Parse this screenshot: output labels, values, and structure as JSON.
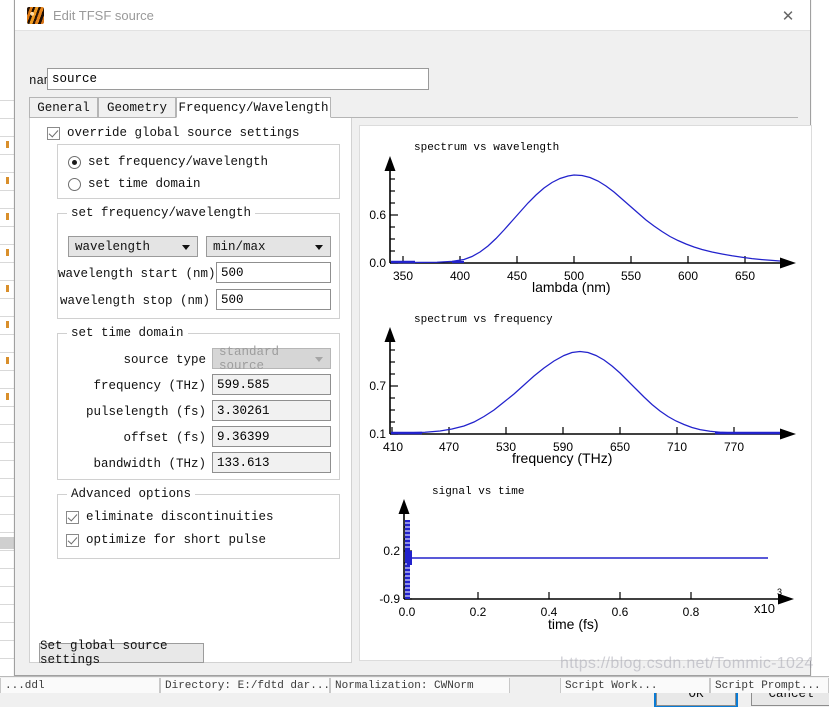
{
  "window": {
    "title": "Edit TFSF source",
    "icon": "lumerical-app-icon",
    "close_label": "✕"
  },
  "name_row": {
    "label": "name",
    "value": "source",
    "placeholder": "name"
  },
  "tabs": [
    {
      "label": "General",
      "active": false
    },
    {
      "label": "Geometry",
      "active": false
    },
    {
      "label": "Frequency/Wavelength",
      "active": true
    }
  ],
  "override": {
    "label": "override global source settings",
    "checked": true
  },
  "mode_radios": [
    {
      "label": "set frequency/wavelength",
      "selected": true
    },
    {
      "label": "set time domain",
      "selected": false
    }
  ],
  "freq_wavelength_group": {
    "legend": "set frequency/wavelength",
    "combo_quantity": {
      "value": "wavelength"
    },
    "combo_range": {
      "value": "min/max"
    },
    "fields": [
      {
        "label": "wavelength start (nm)",
        "value": "500"
      },
      {
        "label": "wavelength stop (nm)",
        "value": "500"
      }
    ]
  },
  "time_domain_group": {
    "legend": "set time domain",
    "source_type": {
      "label": "source type",
      "value": "standard source",
      "disabled": true
    },
    "fields": [
      {
        "label": "frequency (THz)",
        "value": "599.585"
      },
      {
        "label": "pulselength (fs)",
        "value": "3.30261"
      },
      {
        "label": "offset (fs)",
        "value": "9.36399"
      },
      {
        "label": "bandwidth (THz)",
        "value": "133.613"
      }
    ]
  },
  "advanced_group": {
    "legend": "Advanced options",
    "options": [
      {
        "label": "eliminate discontinuities",
        "checked": true
      },
      {
        "label": "optimize for short pulse",
        "checked": true
      }
    ]
  },
  "global_button": {
    "label": "Set global source settings"
  },
  "footer": {
    "ok_label": "OK",
    "cancel_label": "Cancel"
  },
  "watermark": {
    "text": "https://blog.csdn.net/Tommic-1024"
  },
  "colors": {
    "curve": "#2222cc",
    "axis": "#000000",
    "tick_text": "#000000",
    "focus_ring": "#0a7bd4",
    "dialog_bg": "#f0f0f0",
    "panel_bg": "#ffffff"
  },
  "bottom_bar": {
    "cells": [
      "...ddl",
      "Directory: E:/fdtd dar...",
      "Normalization: CWNorm",
      "Script Work...",
      "Script Prompt..."
    ]
  },
  "chart_data": [
    {
      "type": "line",
      "title": "spectrum vs wavelength",
      "xlabel": "lambda (nm)",
      "ylabel": "",
      "xlim": [
        337,
        672
      ],
      "ylim": [
        0.0,
        1.05
      ],
      "xticks": [
        350,
        400,
        450,
        500,
        550,
        600,
        650
      ],
      "yticks": [
        0.0,
        0.6
      ],
      "grid": false,
      "legend": null,
      "peak_x": 500,
      "peak_y": 1.0,
      "x": [
        350,
        360,
        370,
        380,
        390,
        400,
        410,
        420,
        430,
        440,
        450,
        460,
        470,
        480,
        490,
        500,
        510,
        520,
        530,
        540,
        550,
        560,
        570,
        580,
        590,
        600,
        610,
        620,
        630,
        640,
        650,
        660,
        670
      ],
      "y": [
        0.0,
        0.0,
        0.0,
        0.0,
        0.005,
        0.02,
        0.06,
        0.13,
        0.24,
        0.39,
        0.56,
        0.72,
        0.86,
        0.95,
        0.995,
        1.0,
        0.985,
        0.95,
        0.89,
        0.81,
        0.71,
        0.62,
        0.52,
        0.44,
        0.36,
        0.29,
        0.23,
        0.18,
        0.14,
        0.1,
        0.07,
        0.045,
        0.02
      ]
    },
    {
      "type": "line",
      "title": "spectrum vs frequency",
      "xlabel": "frequency (THz)",
      "ylabel": "",
      "xlim": [
        410,
        800
      ],
      "ylim": [
        0.1,
        1.05
      ],
      "xticks": [
        410,
        470,
        530,
        590,
        650,
        710,
        770
      ],
      "yticks": [
        0.1,
        0.7
      ],
      "grid": false,
      "legend": null,
      "peak_x": 600,
      "peak_y": 1.0,
      "x": [
        410,
        430,
        450,
        470,
        490,
        510,
        530,
        550,
        570,
        590,
        600,
        610,
        630,
        650,
        670,
        690,
        710,
        730,
        750,
        770,
        790
      ],
      "y": [
        0.1,
        0.105,
        0.12,
        0.15,
        0.21,
        0.31,
        0.45,
        0.62,
        0.8,
        0.96,
        1.0,
        0.99,
        0.93,
        0.81,
        0.65,
        0.49,
        0.34,
        0.23,
        0.16,
        0.12,
        0.1
      ]
    },
    {
      "type": "line",
      "title": "signal vs time",
      "xlabel": "time (fs)",
      "ylabel": "",
      "x_exponent": "x10",
      "x_exponent_power": "3",
      "xlim": [
        0.0,
        1.0
      ],
      "ylim": [
        -0.9,
        1.0
      ],
      "xticks": [
        0.0,
        0.2,
        0.4,
        0.6,
        0.8
      ],
      "yticks": [
        -0.9,
        0.2
      ],
      "grid": false,
      "legend": null,
      "description": "Very short pulse burst near t=0 (dense oscillation filling -0.9..1.0), then flat baseline at ~0.12",
      "baseline_y": 0.12,
      "burst_x_range": [
        0.0,
        0.012
      ]
    }
  ]
}
